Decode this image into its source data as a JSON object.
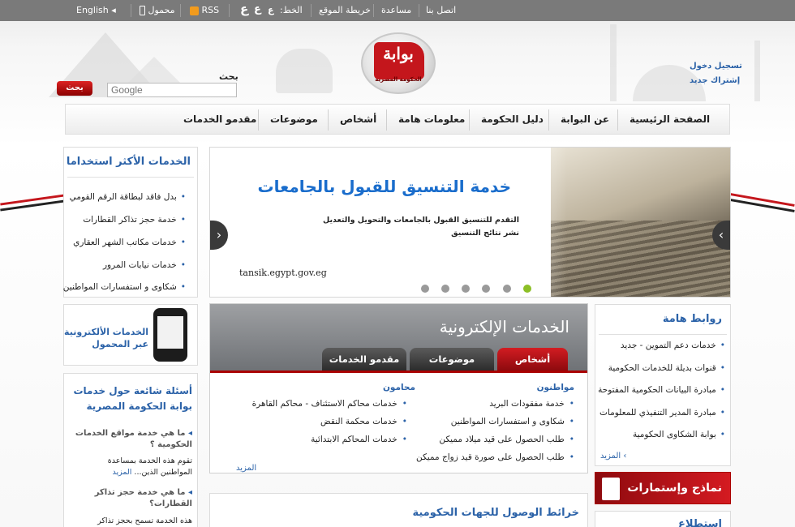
{
  "topbar": {
    "english": "English",
    "mobile": "محمول",
    "rss": "RSS",
    "font_sizes": [
      "ع",
      "ع",
      "ع"
    ],
    "font_label": "الخط:",
    "sitemap": "خريطة الموقع",
    "help": "مساعدة",
    "contact": "اتصل بنا"
  },
  "search": {
    "label": "بحث",
    "button": "بحث",
    "placeholder": "Google"
  },
  "account": {
    "login": "تسجيل دخول",
    "signup": "إشتراك جديد"
  },
  "logo": {
    "line1": "بوابة",
    "line2": "الحكومة المصرية"
  },
  "nav": [
    "الصفحة الرئيسية",
    "عن البوابة",
    "دليل الحكومة",
    "معلومات هامة",
    "أشخاص",
    "موضوعات",
    "مقدمو الخدمات"
  ],
  "most_used": {
    "title": "الخدمات الأكثر استخداما",
    "items": [
      "بدل فاقد لبطاقة الرقم القومي",
      "خدمة حجز تذاكر القطارات",
      "خدمات مكاتب الشهر العقاري",
      "خدمات نيابات المرور",
      "شكاوى و استفسارات المواطنين"
    ]
  },
  "slider": {
    "title": "خدمة التنسيق للقبول بالجامعات",
    "line1": "التقدم للتنسيق القبول بالجامعات والتحويل والتعديل",
    "line2": "نشر نتائج التنسيق",
    "url": "tansik.egypt.gov.eg",
    "dots": 6,
    "active_dot": 0
  },
  "mobile_promo": {
    "line1": "الخدمات الألكترونية",
    "line2": "عبر المحمول"
  },
  "faq": {
    "title_line1": "أسئلة شائعة حول خدمات",
    "title_line2": "بوابة الحكومة المصرية",
    "q1": "ما هي خدمة مواقع الخدمات الحكومية ؟",
    "a1_line1": "تقوم هذه الخدمة بمساعدة",
    "a1_line2": "المواطنين الذين...",
    "more": "المزيد",
    "q2": "ما هي خدمة حجز تذاكر القطارات؟",
    "a2_line1": "هذه الخدمة تسمح بحجز تذاكر"
  },
  "eservices": {
    "title": "الخدمات الإلكترونية",
    "tabs": [
      "أشخاص",
      "موضوعات",
      "مقدمو الخدمات"
    ],
    "col1_title": "مواطنون",
    "col1_items": [
      "خدمة مفقودات البريد",
      "شكاوى و استفسارات المواطنين",
      "طلب الحصول على قيد ميلاد مميكن",
      "طلب الحصول على صورة قيد زواج مميكن"
    ],
    "col2_title": "محامون",
    "col2_items": [
      "خدمات محاكم الاستئناف - محاكم القاهرة",
      "خدمات محكمة النقض",
      "خدمات المحاكم الابتدائية"
    ],
    "more": "المزيد"
  },
  "links": {
    "title": "روابط هامة",
    "items": [
      "خدمات دعم التموين - جديد",
      "قنوات بديلة للخدمات الحكومية",
      "مبادرة البيانات الحكومية المفتوحة",
      "مبادرة المدير التنفيذي للمعلومات",
      "بوابة الشكاوى الحكومية"
    ],
    "more": "المزيد"
  },
  "forms_banner": "نماذج وإستمارات",
  "maps": {
    "title": "خرائط الوصول للجهات الحكومية"
  },
  "poll": {
    "title": "استطلاع"
  }
}
